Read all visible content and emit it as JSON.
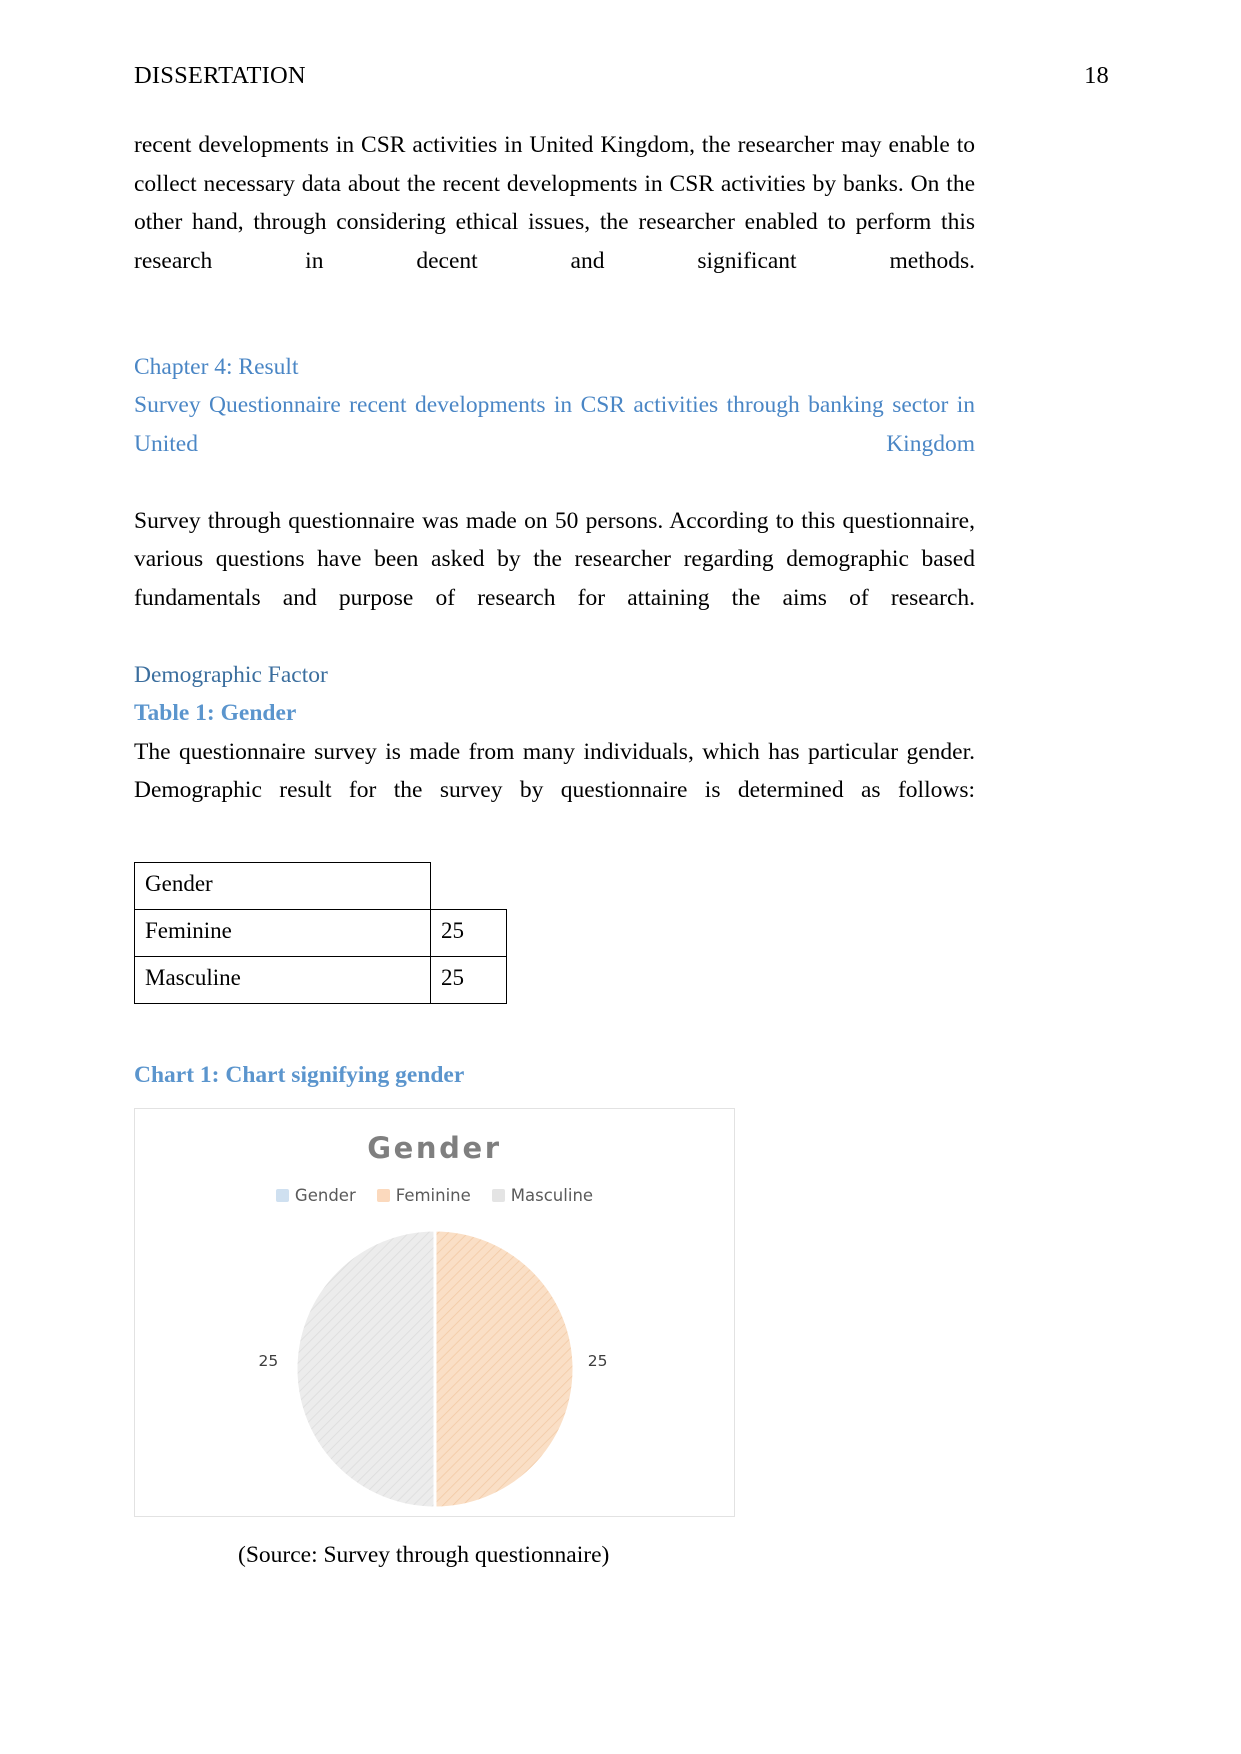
{
  "header": {
    "document_title": "DISSERTATION",
    "page_number": "18"
  },
  "body": {
    "paragraph_1": "recent developments in CSR activities in United Kingdom, the researcher may enable to collect necessary data about the recent developments in CSR activities by banks. On the other hand, through considering ethical issues, the researcher enabled to perform this research in decent and significant methods.",
    "chapter_heading": "Chapter 4: Result",
    "section_heading": "Survey Questionnaire recent developments in CSR activities through banking sector in United Kingdom",
    "paragraph_2": "Survey through questionnaire was made on 50 persons. According to this questionnaire, various questions have been asked by the researcher regarding demographic based fundamentals and purpose of research for attaining the aims of research.",
    "subsection_heading": "Demographic Factor",
    "table_caption": "Table 1: Gender",
    "paragraph_3": "The questionnaire survey is made from many individuals, which has particular gender. Demographic result for the survey by questionnaire is determined as follows:",
    "chart_caption": "Chart 1: Chart signifying gender",
    "source_note": "(Source: Survey through questionnaire)"
  },
  "table": {
    "header_cell": "Gender",
    "rows": [
      {
        "label": "Feminine",
        "value": "25"
      },
      {
        "label": "Masculine",
        "value": "25"
      }
    ]
  },
  "chart_data": {
    "type": "pie",
    "title": "Gender",
    "categories": [
      "Feminine",
      "Masculine"
    ],
    "values": [
      25,
      25
    ],
    "data_labels": [
      "25",
      "25"
    ],
    "legend": [
      "Gender",
      "Feminine",
      "Masculine"
    ],
    "legend_position": "top",
    "legend_colors": [
      "#cfe0f0",
      "#fbd9bd",
      "#e4e4e4"
    ],
    "slice_colors": [
      "#fadfc6",
      "#e8e8e8"
    ],
    "grid": false,
    "xlabel": "",
    "ylabel": ""
  },
  "colors": {
    "heading_blue": "#4a86c5",
    "subsection_blue": "#3b6e9e",
    "caption_blue": "#5b95cd",
    "chart_title_gray": "#7f7f7f",
    "feminine_slice": "#fadfc6",
    "masculine_slice": "#e8e8e8",
    "table_border": "#000000"
  }
}
